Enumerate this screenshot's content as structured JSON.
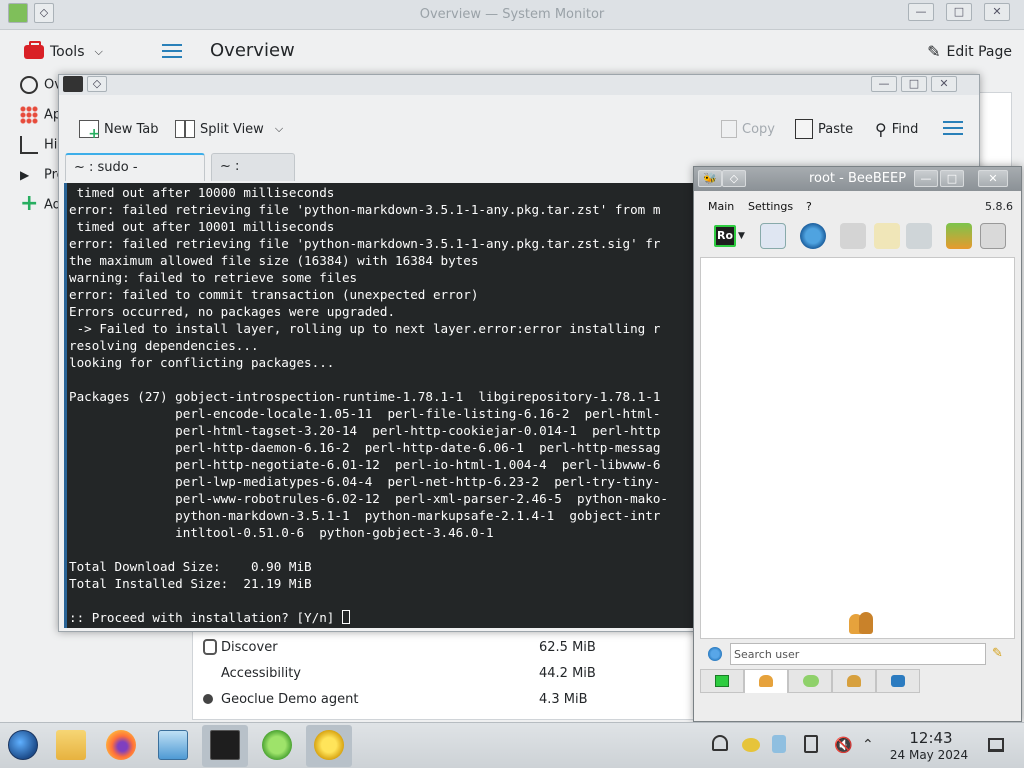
{
  "system_monitor": {
    "window_title": "Overview — System Monitor",
    "tools_label": "Tools",
    "page_title": "Overview",
    "edit_page_label": "Edit Page",
    "sidebar": [
      {
        "label": "Overview"
      },
      {
        "label": "Applications"
      },
      {
        "label": "History"
      },
      {
        "label": "Processes"
      },
      {
        "label": "Add New Page"
      }
    ],
    "processes": [
      {
        "name": "Discover",
        "memory": "62.5 MiB"
      },
      {
        "name": "Accessibility",
        "memory": "44.2 MiB"
      },
      {
        "name": "Geoclue Demo agent",
        "memory": "4.3 MiB"
      }
    ]
  },
  "konsole": {
    "toolbar": {
      "new_tab": "New Tab",
      "split_view": "Split View",
      "copy": "Copy",
      "paste": "Paste",
      "find": "Find"
    },
    "tabs": [
      {
        "label": "~ : sudo -uauruser",
        "active": true
      },
      {
        "label": "~ : bash",
        "active": false
      }
    ],
    "terminal_lines": [
      " timed out after 10000 milliseconds",
      "error: failed retrieving file 'python-markdown-3.5.1-1-any.pkg.tar.zst' from m",
      " timed out after 10001 milliseconds",
      "error: failed retrieving file 'python-markdown-3.5.1-1-any.pkg.tar.zst.sig' fr",
      "the maximum allowed file size (16384) with 16384 bytes",
      "warning: failed to retrieve some files",
      "error: failed to commit transaction (unexpected error)",
      "Errors occurred, no packages were upgraded.",
      " -> Failed to install layer, rolling up to next layer.error:error installing r",
      "resolving dependencies...",
      "looking for conflicting packages...",
      "",
      "Packages (27) gobject-introspection-runtime-1.78.1-1  libgirepository-1.78.1-1",
      "              perl-encode-locale-1.05-11  perl-file-listing-6.16-2  perl-html-",
      "              perl-html-tagset-3.20-14  perl-http-cookiejar-0.014-1  perl-http",
      "              perl-http-daemon-6.16-2  perl-http-date-6.06-1  perl-http-messag",
      "              perl-http-negotiate-6.01-12  perl-io-html-1.004-4  perl-libwww-6",
      "              perl-lwp-mediatypes-6.04-4  perl-net-http-6.23-2  perl-try-tiny-",
      "              perl-www-robotrules-6.02-12  perl-xml-parser-2.46-5  python-mako-",
      "              python-markdown-3.5.1-1  python-markupsafe-2.1.4-1  gobject-intr",
      "              intltool-0.51.0-6  python-gobject-3.46.0-1",
      "",
      "Total Download Size:    0.90 MiB",
      "Total Installed Size:  21.19 MiB",
      "",
      ":: Proceed with installation? [Y/n] "
    ]
  },
  "beebeep": {
    "window_title": "root - BeeBEEP",
    "menu": [
      "Main",
      "Settings",
      "?"
    ],
    "version": "5.8.6",
    "status_badge": "Ro",
    "search_placeholder": "Search user"
  },
  "taskbar": {
    "time": "12:43",
    "date": "24 May 2024"
  },
  "colors": {
    "terminal_bg": "#232627",
    "terminal_fg": "#fcfcfc",
    "accent": "#3daee9",
    "taskbar_bg": "#d6dadd"
  }
}
